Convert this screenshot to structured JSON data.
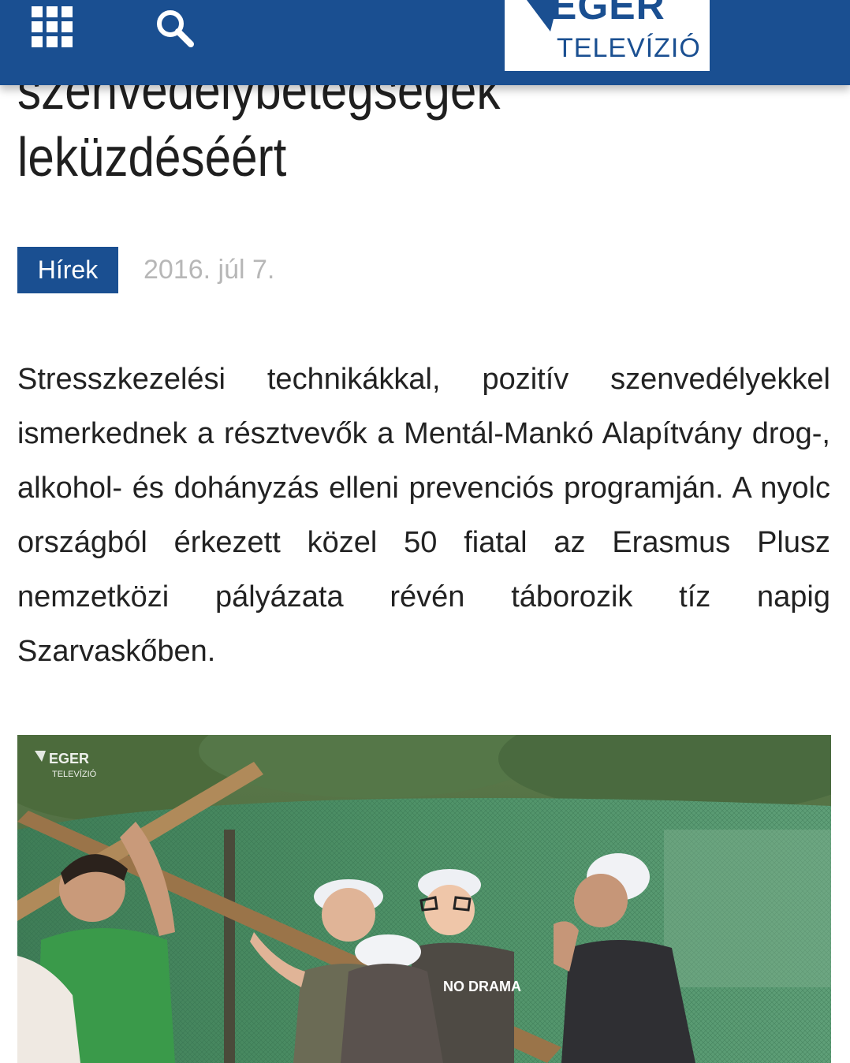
{
  "header": {
    "menu_icon": "grid-menu-icon",
    "search_icon": "search-icon",
    "logo": {
      "brand": "EGER",
      "subtitle": "TELEVÍZIÓ"
    }
  },
  "article": {
    "title_lines": [
      "szenvedélybetegségek",
      "leküzdéséért"
    ],
    "category": "Hírek",
    "date": "2016. júl 7.",
    "lead": "Stresszkezelési technikákkal, pozitív szenvedélyekkel ismerkednek a résztvevők a Mentál-Mankó Alapítvány drog-, alkohol- és dohányzás elleni prevenciós programján. A nyolc országból érkezett közel 50 fiatal az Erasmus Plusz nemzetközi pályázata révén táborozik tíz napig Szarvaskőben."
  },
  "photo": {
    "watermark_brand": "EGER",
    "watermark_subtitle": "TELEVÍZIÓ",
    "shirt_text": "NO DRAMA"
  },
  "colors": {
    "brand_blue": "#1a4f91",
    "date_gray": "#b7b7b7",
    "text": "#222222"
  }
}
